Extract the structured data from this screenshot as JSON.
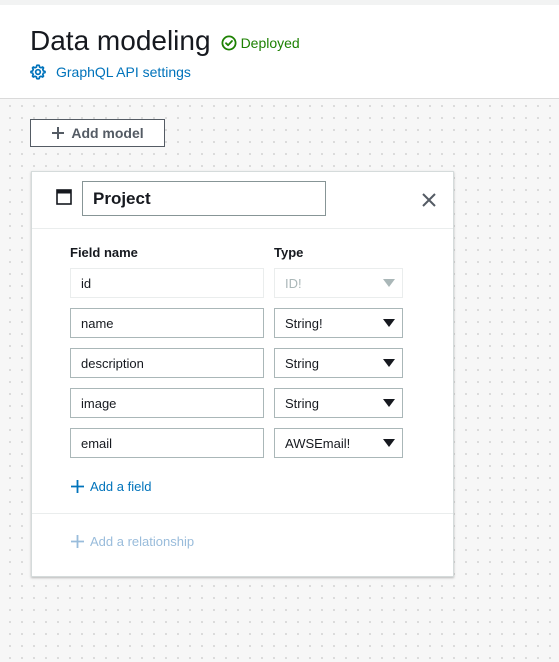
{
  "header": {
    "title": "Data modeling",
    "status": "Deployed",
    "settings_link": "GraphQL API settings"
  },
  "toolbar": {
    "add_model_label": "Add model"
  },
  "model": {
    "name": "Project",
    "columns": {
      "field_name": "Field name",
      "type": "Type"
    },
    "fields": [
      {
        "name": "id",
        "type": "ID!",
        "disabled": true
      },
      {
        "name": "name",
        "type": "String!",
        "disabled": false
      },
      {
        "name": "description",
        "type": "String",
        "disabled": false
      },
      {
        "name": "image",
        "type": "String",
        "disabled": false
      },
      {
        "name": "email",
        "type": "AWSEmail!",
        "disabled": false
      }
    ],
    "add_field_label": "Add a field",
    "add_relationship_label": "Add a relationship"
  },
  "colors": {
    "success": "#1d8102",
    "link": "#0073bb",
    "link_disabled": "#99bcdb",
    "text": "#16191f"
  },
  "icons": {
    "status": "check-circle-icon",
    "settings": "gear-icon",
    "add": "plus-icon",
    "model": "window-icon",
    "close": "close-icon",
    "caret": "caret-down-icon"
  }
}
